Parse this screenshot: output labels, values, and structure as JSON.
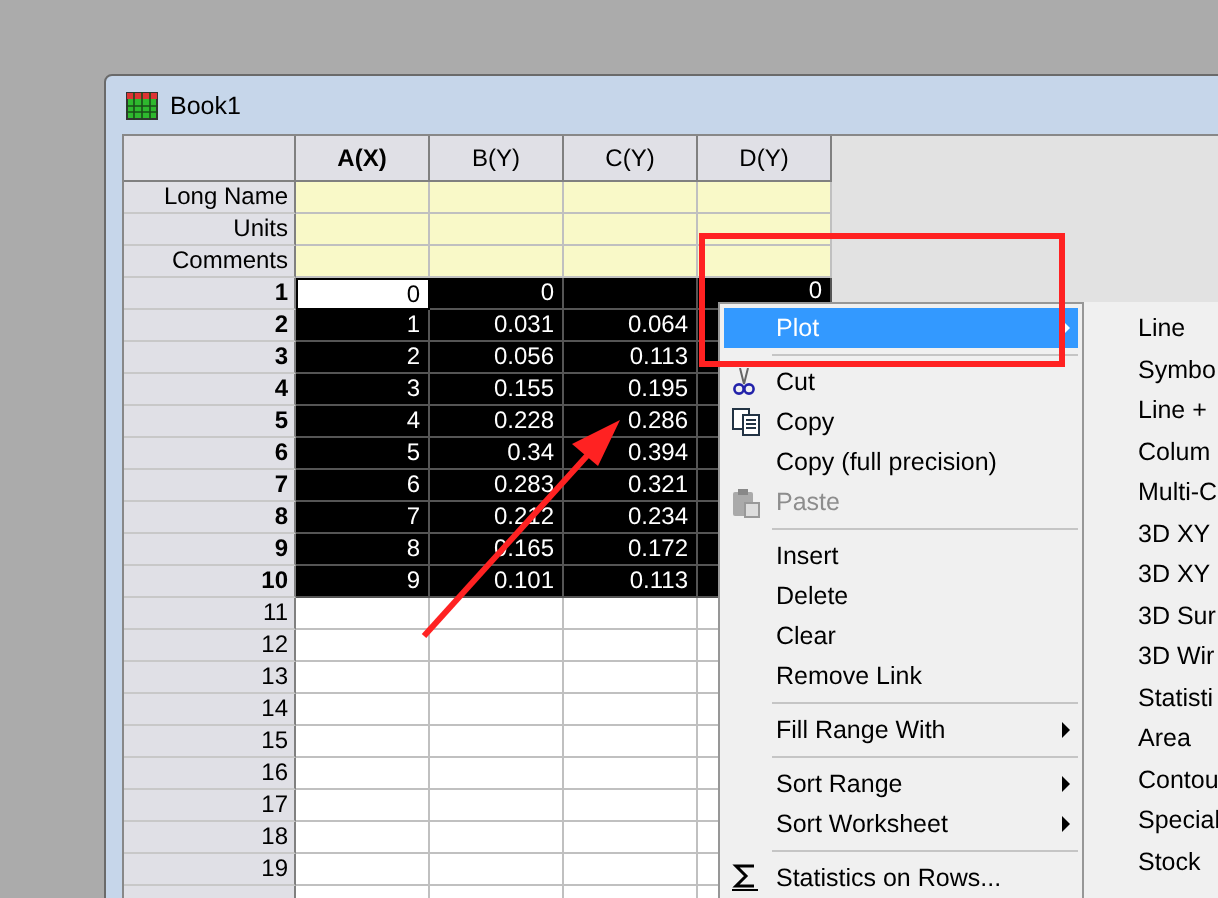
{
  "window": {
    "title": "Book1"
  },
  "table": {
    "columns": [
      {
        "label": "A(X)",
        "kind": "x"
      },
      {
        "label": "B(Y)",
        "kind": "y"
      },
      {
        "label": "C(Y)",
        "kind": "y"
      },
      {
        "label": "D(Y)",
        "kind": "y"
      }
    ],
    "label_rows": [
      "Long Name",
      "Units",
      "Comments"
    ],
    "rows": [
      {
        "label": "1",
        "selected": true,
        "first_cell_active": true,
        "cells": [
          "0",
          "0",
          "",
          "0"
        ]
      },
      {
        "label": "2",
        "selected": true,
        "first_cell_active": false,
        "cells": [
          "1",
          "0.031",
          "0.064"
        ]
      },
      {
        "label": "3",
        "selected": true,
        "first_cell_active": false,
        "cells": [
          "2",
          "0.056",
          "0.113"
        ]
      },
      {
        "label": "4",
        "selected": true,
        "first_cell_active": false,
        "cells": [
          "3",
          "0.155",
          "0.195"
        ]
      },
      {
        "label": "5",
        "selected": true,
        "first_cell_active": false,
        "cells": [
          "4",
          "0.228",
          "0.286"
        ]
      },
      {
        "label": "6",
        "selected": true,
        "first_cell_active": false,
        "cells": [
          "5",
          "0.34",
          "0.394"
        ]
      },
      {
        "label": "7",
        "selected": true,
        "first_cell_active": false,
        "cells": [
          "6",
          "0.283",
          "0.321"
        ]
      },
      {
        "label": "8",
        "selected": true,
        "first_cell_active": false,
        "cells": [
          "7",
          "0.212",
          "0.234"
        ]
      },
      {
        "label": "9",
        "selected": true,
        "first_cell_active": false,
        "cells": [
          "8",
          "0.165",
          "0.172"
        ]
      },
      {
        "label": "10",
        "selected": true,
        "first_cell_active": false,
        "cells": [
          "9",
          "0.101",
          "0.113"
        ]
      },
      {
        "label": "11",
        "selected": false,
        "first_cell_active": false
      },
      {
        "label": "12",
        "selected": false,
        "first_cell_active": false
      },
      {
        "label": "13",
        "selected": false,
        "first_cell_active": false
      },
      {
        "label": "14",
        "selected": false,
        "first_cell_active": false
      },
      {
        "label": "15",
        "selected": false,
        "first_cell_active": false
      },
      {
        "label": "16",
        "selected": false,
        "first_cell_active": false
      },
      {
        "label": "17",
        "selected": false,
        "first_cell_active": false
      },
      {
        "label": "18",
        "selected": false,
        "first_cell_active": false
      },
      {
        "label": "19",
        "selected": false,
        "first_cell_active": false
      }
    ]
  },
  "context_menu": {
    "items": [
      {
        "kind": "item",
        "label": "Plot",
        "selected": true,
        "disabled": false,
        "submenu": true
      },
      {
        "kind": "separator"
      },
      {
        "kind": "item",
        "label": "Cut",
        "selected": false,
        "disabled": false,
        "submenu": false
      },
      {
        "kind": "item",
        "label": "Copy",
        "selected": false,
        "disabled": false,
        "submenu": false
      },
      {
        "kind": "item",
        "label": "Copy (full precision)",
        "selected": false,
        "disabled": false,
        "submenu": false
      },
      {
        "kind": "item",
        "label": "Paste",
        "selected": false,
        "disabled": true,
        "submenu": false
      },
      {
        "kind": "separator"
      },
      {
        "kind": "item",
        "label": "Insert",
        "selected": false,
        "disabled": false,
        "submenu": false
      },
      {
        "kind": "item",
        "label": "Delete",
        "selected": false,
        "disabled": false,
        "submenu": false
      },
      {
        "kind": "item",
        "label": "Clear",
        "selected": false,
        "disabled": false,
        "submenu": false
      },
      {
        "kind": "item",
        "label": "Remove Link",
        "selected": false,
        "disabled": false,
        "submenu": false
      },
      {
        "kind": "separator"
      },
      {
        "kind": "item",
        "label": "Fill Range With",
        "selected": false,
        "disabled": false,
        "submenu": true
      },
      {
        "kind": "separator"
      },
      {
        "kind": "item",
        "label": "Sort Range",
        "selected": false,
        "disabled": false,
        "submenu": true
      },
      {
        "kind": "item",
        "label": "Sort Worksheet",
        "selected": false,
        "disabled": false,
        "submenu": true
      },
      {
        "kind": "separator"
      },
      {
        "kind": "item",
        "label": "Statistics on Rows...",
        "selected": false,
        "disabled": false,
        "submenu": false
      }
    ]
  },
  "submenu": {
    "items": [
      "Line",
      "Symbo",
      "Line +",
      "Colum",
      "Multi-C",
      "3D XY",
      "3D XY",
      "3D Sur",
      "3D Wir",
      "Statisti",
      "Area",
      "Contou",
      "Special",
      "Stock"
    ]
  }
}
